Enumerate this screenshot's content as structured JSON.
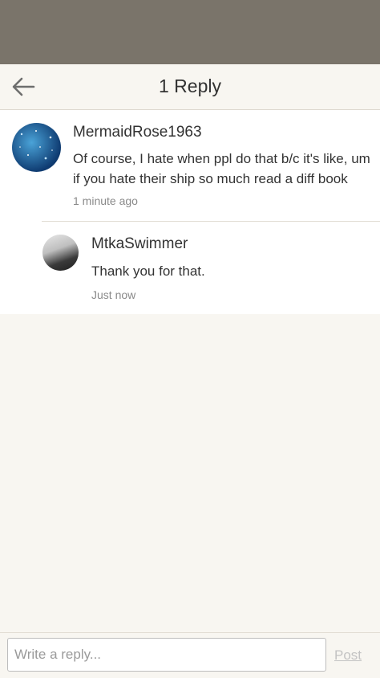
{
  "header": {
    "title": "1 Reply",
    "back_icon": "arrow-left-icon"
  },
  "comment": {
    "author": "MermaidRose1963",
    "text": "Of course, I hate when ppl do that b/c it's like, um if you hate their ship so much read a diff book",
    "time": "1 minute ago"
  },
  "reply": {
    "author": "MtkaSwimmer",
    "text": "Thank you for that.",
    "time": "Just now"
  },
  "footer": {
    "placeholder": "Write a reply...",
    "post_label": "Post"
  },
  "colors": {
    "statusbar": "#7a746a",
    "background": "#f8f6f1",
    "post_disabled": "#c3c3c3"
  }
}
